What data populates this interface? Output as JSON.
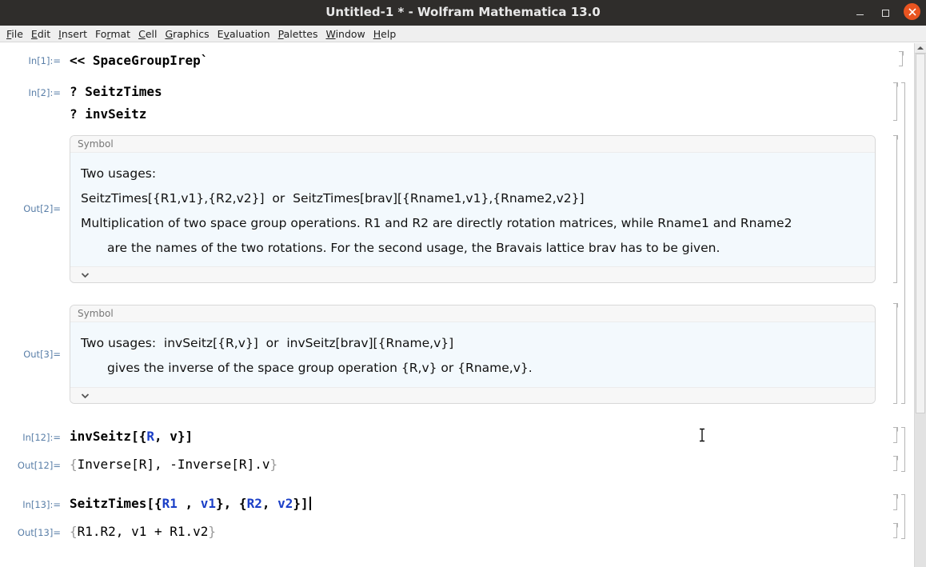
{
  "window": {
    "title": "Untitled-1 * - Wolfram Mathematica 13.0",
    "controls": [
      "minimize",
      "maximize",
      "close"
    ]
  },
  "menubar": {
    "items": [
      {
        "label": "File",
        "mnemonic_index": 0
      },
      {
        "label": "Edit",
        "mnemonic_index": 0
      },
      {
        "label": "Insert",
        "mnemonic_index": 0
      },
      {
        "label": "Format",
        "mnemonic_index": 2
      },
      {
        "label": "Cell",
        "mnemonic_index": 0
      },
      {
        "label": "Graphics",
        "mnemonic_index": 0
      },
      {
        "label": "Evaluation",
        "mnemonic_index": 1
      },
      {
        "label": "Palettes",
        "mnemonic_index": 0
      },
      {
        "label": "Window",
        "mnemonic_index": 0
      },
      {
        "label": "Help",
        "mnemonic_index": 0
      }
    ]
  },
  "cells": {
    "in1": {
      "label": "In[1]:=",
      "code": "<< SpaceGroupIrep`"
    },
    "in2": {
      "label": "In[2]:=",
      "line1": "? SeitzTimes",
      "line2": "? invSeitz"
    },
    "out2": {
      "label": "Out[2]=",
      "header": "Symbol",
      "lines": [
        "Two usages:",
        "SeitzTimes[{R1,v1},{R2,v2}]  or  SeitzTimes[brav][{Rname1,v1},{Rname2,v2}]",
        "Multiplication of two space group operations. R1 and R2 are directly rotation matrices, while Rname1 and Rname2",
        "are the names of the two rotations. For the second usage, the Bravais lattice brav has to be given."
      ]
    },
    "out3": {
      "label": "Out[3]=",
      "header": "Symbol",
      "lines": [
        "Two usages:  invSeitz[{R,v}]  or  invSeitz[brav][{Rname,v}]",
        "gives the inverse of the space group operation {R,v} or {Rname,v}."
      ]
    },
    "in12": {
      "label": "In[12]:=",
      "head": "invSeitz",
      "open": "[{",
      "arg1": "R",
      "sep": ", ",
      "arg2": "v",
      "close": "}]"
    },
    "out12": {
      "label": "Out[12]=",
      "lbrace": "{",
      "body": "Inverse[R], -Inverse[R].v",
      "rbrace": "}"
    },
    "in13": {
      "label": "In[13]:=",
      "head": "SeitzTimes",
      "p1": "[{",
      "a1": "R1",
      "p2": " , ",
      "a2": "v1",
      "p3": "}, {",
      "a3": "R2",
      "p4": ", ",
      "a4": "v2",
      "p5": "}]"
    },
    "out13": {
      "label": "Out[13]=",
      "lbrace": "{",
      "body": "R1.R2, v1 + R1.v2",
      "rbrace": "}"
    }
  },
  "colors": {
    "titlebar": "#2f2d2b",
    "close_button": "#e95420",
    "cell_label": "#5a7fa8",
    "symbol_blue": "#1b3fc7",
    "info_box_bg": "#f3f9fd"
  }
}
